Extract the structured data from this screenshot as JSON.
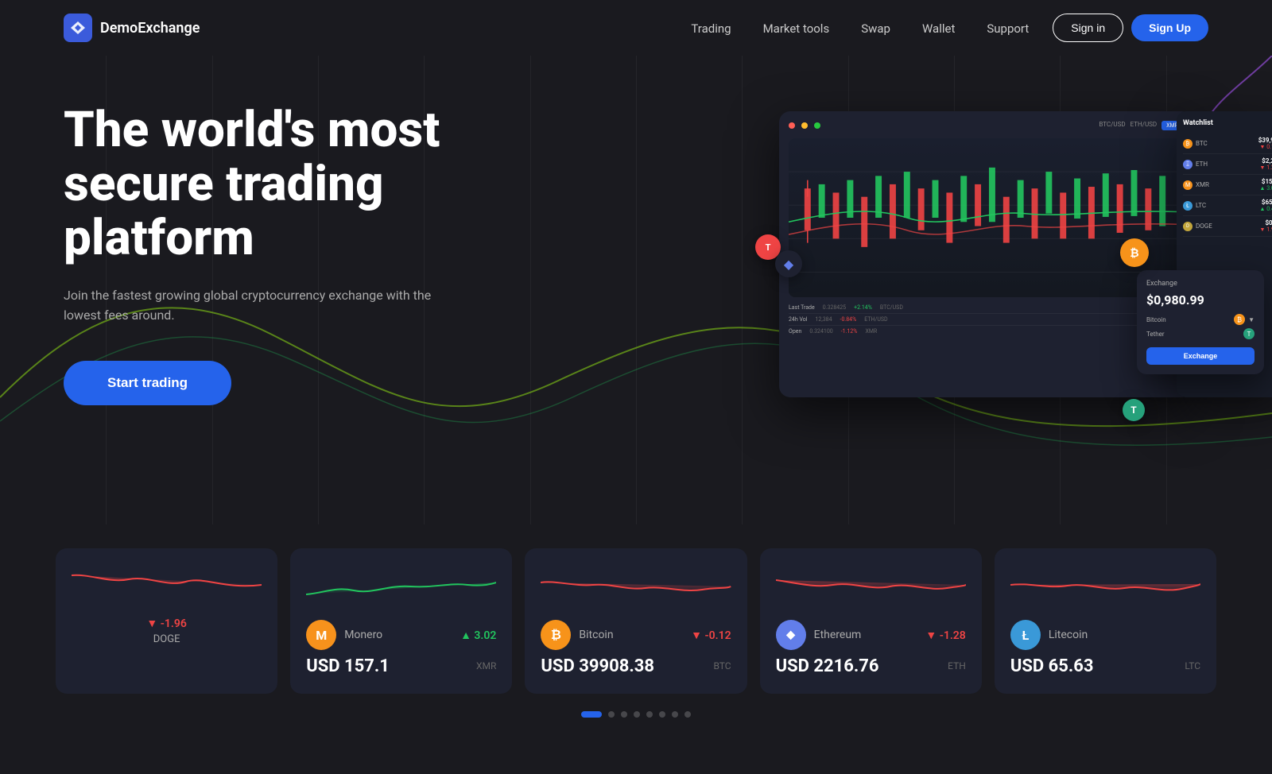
{
  "brand": {
    "name": "DemoExchange",
    "logo_symbol": "◈"
  },
  "nav": {
    "links": [
      {
        "label": "Trading",
        "id": "trading"
      },
      {
        "label": "Market tools",
        "id": "market-tools"
      },
      {
        "label": "Swap",
        "id": "swap"
      },
      {
        "label": "Wallet",
        "id": "wallet"
      },
      {
        "label": "Support",
        "id": "support"
      }
    ],
    "signin_label": "Sign in",
    "signup_label": "Sign Up"
  },
  "hero": {
    "title": "The world's most secure trading platform",
    "subtitle": "Join the fastest growing global cryptocurrency exchange with the lowest fees around.",
    "cta_label": "Start trading"
  },
  "cards": [
    {
      "id": "doge",
      "name": "DOGE",
      "symbol": "DOGE",
      "change": "-1.96",
      "change_positive": false,
      "price": null,
      "color": "#ef4444",
      "icon_text": null,
      "icon_class": "doge"
    },
    {
      "id": "xmr",
      "name": "Monero",
      "symbol": "XMR",
      "change": "3.02",
      "change_positive": true,
      "price": "USD 157.1",
      "color": "#f7921c",
      "icon_text": "M",
      "icon_class": "xmr"
    },
    {
      "id": "btc",
      "name": "Bitcoin",
      "symbol": "BTC",
      "change": "-0.12",
      "change_positive": false,
      "price": "USD 39908.38",
      "color": "#f7931a",
      "icon_text": "₿",
      "icon_class": "btc"
    },
    {
      "id": "eth",
      "name": "Ethereum",
      "symbol": "ETH",
      "change": "-1.28",
      "change_positive": false,
      "price": "USD 2216.76",
      "color": "#627eea",
      "icon_text": "Ξ",
      "icon_class": "eth"
    },
    {
      "id": "ltc",
      "name": "Litecoin",
      "symbol": "LTC",
      "change": null,
      "change_positive": false,
      "price": "USD 65.63",
      "color": "#3a99d8",
      "icon_text": "Ł",
      "icon_class": "ltc"
    }
  ],
  "pagination": {
    "total": 8,
    "active": 0
  }
}
